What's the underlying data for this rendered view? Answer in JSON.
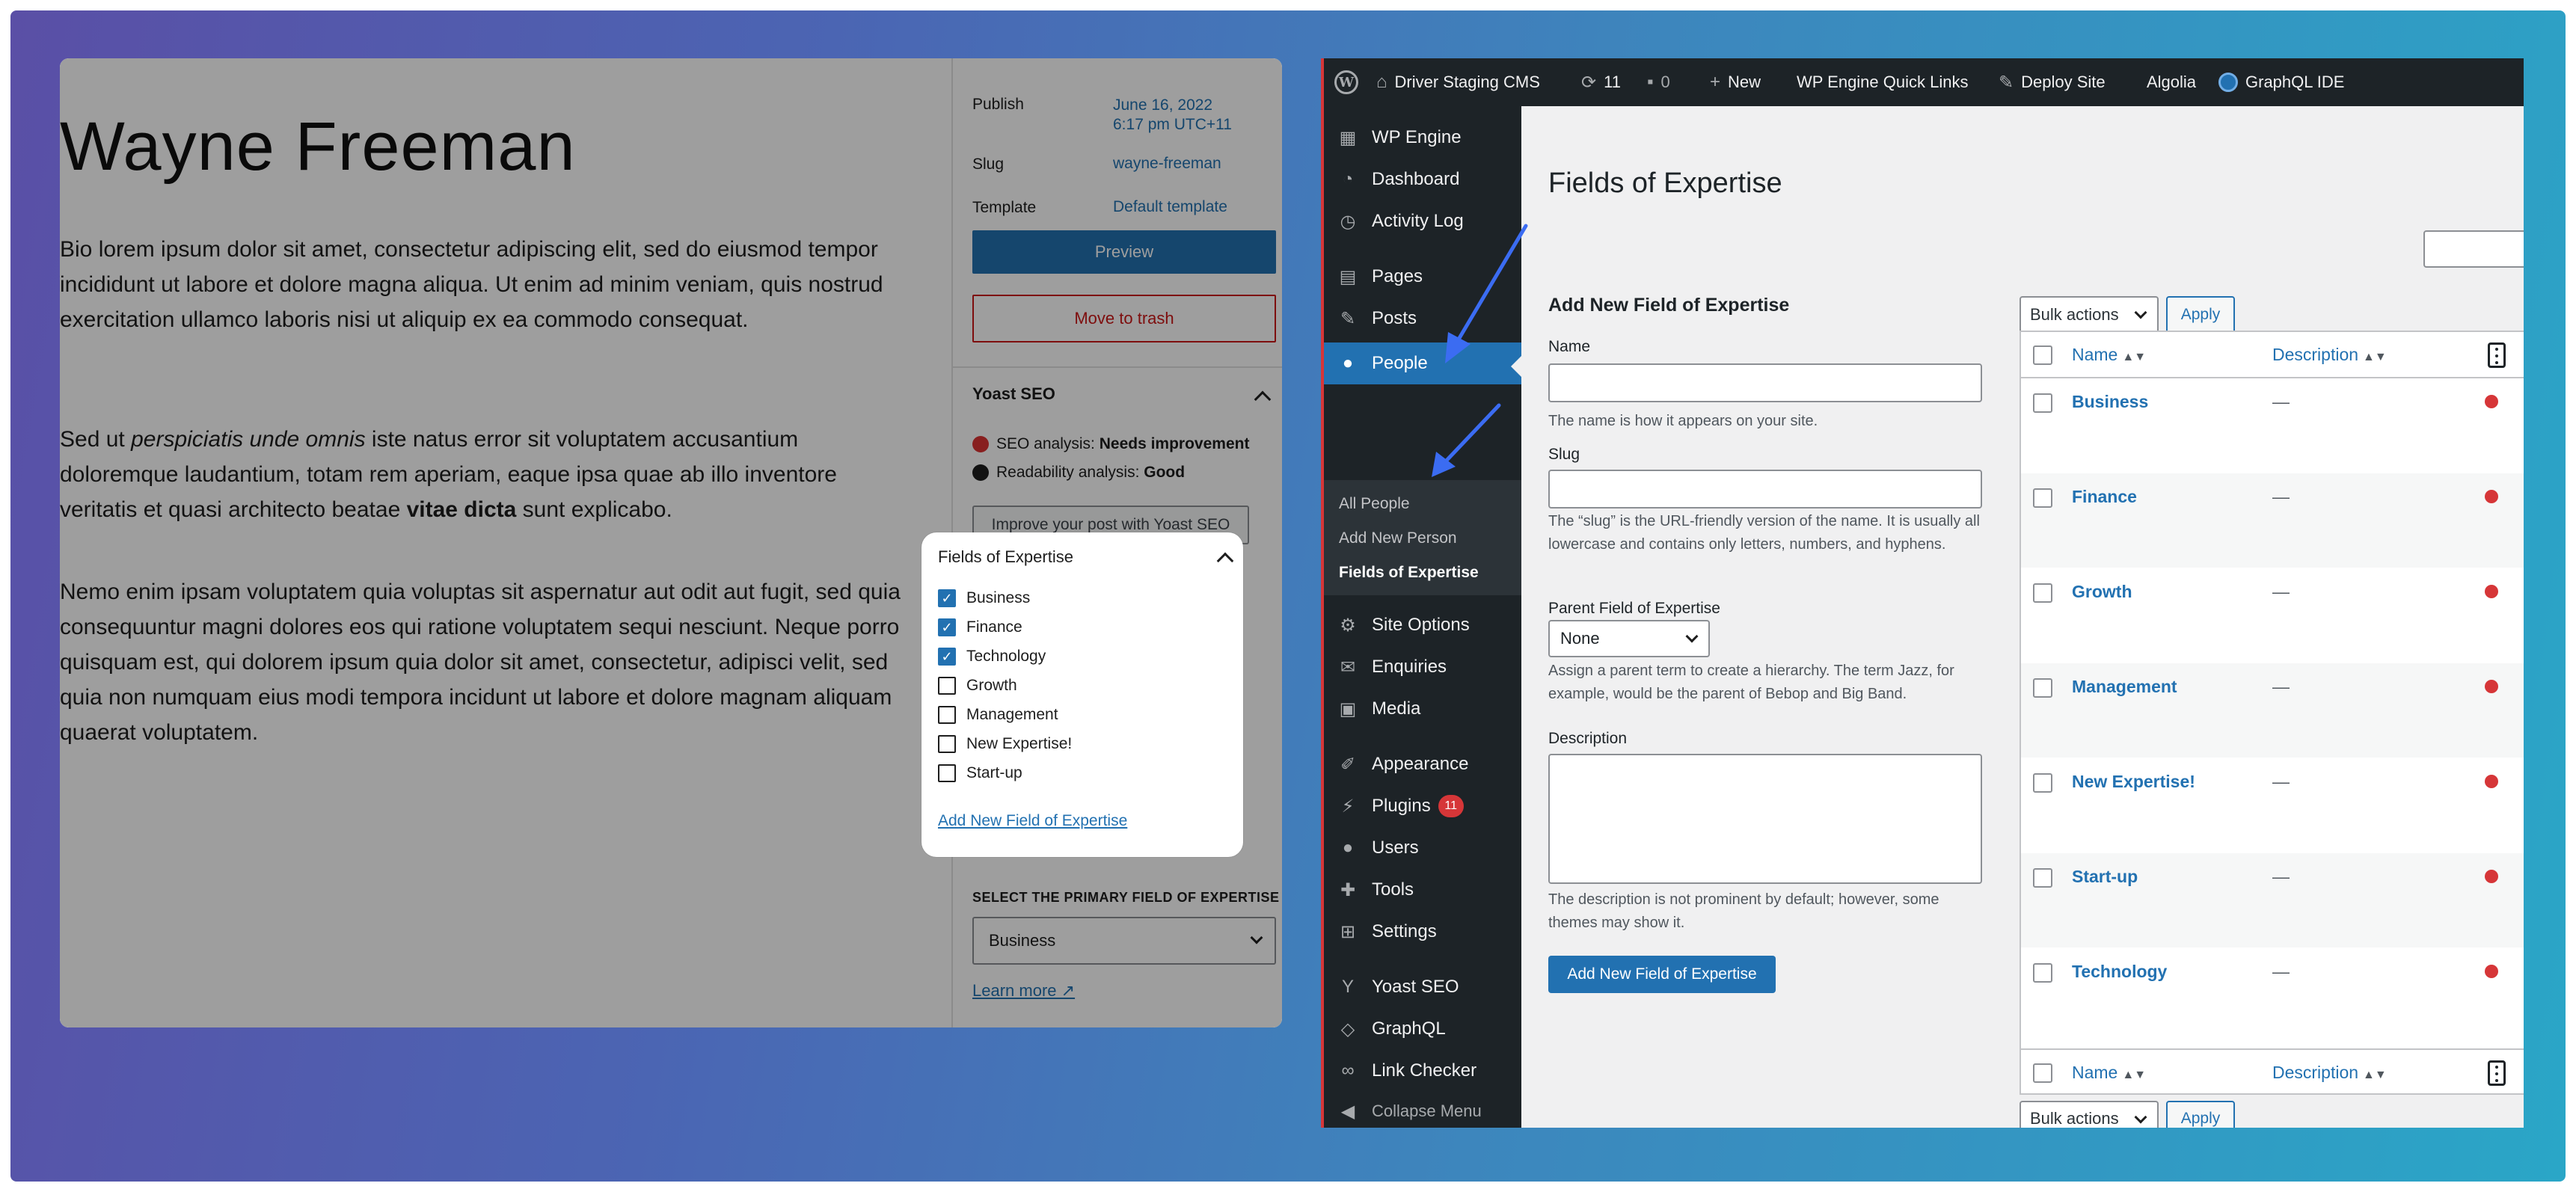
{
  "editor": {
    "post_title": "Wayne Freeman",
    "p1": "Bio lorem ipsum dolor sit amet, consectetur adipiscing elit, sed do eiusmod tempor incididunt ut labore et dolore magna aliqua. Ut enim ad minim veniam, quis nostrud exercitation ullamco laboris nisi ut aliquip ex ea commodo consequat.",
    "p2_a": "Sed ut ",
    "p2_em": "perspiciatis unde omnis",
    "p2_b": " iste natus error sit voluptatem accusantium doloremque laudantium, totam rem aperiam, eaque ipsa quae ab illo inventore veritatis et quasi architecto beatae ",
    "p2_strong": "vitae dicta",
    "p2_c": " sunt explicabo.",
    "p3": "Nemo enim ipsam voluptatem quia voluptas sit aspernatur aut odit aut fugit, sed quia consequuntur magni dolores eos qui ratione voluptatem sequi nesciunt. Neque porro quisquam est, qui dolorem ipsum quia dolor sit amet, consectetur, adipisci velit, sed quia non numquam eius modi tempora incidunt ut labore et dolore magnam aliquam quaerat voluptatem."
  },
  "sidebar": {
    "publish_label": "Publish",
    "publish_date": "June 16, 2022",
    "publish_time": "6:17 pm UTC+11",
    "slug_label": "Slug",
    "slug_value": "wayne-freeman",
    "template_label": "Template",
    "template_value": "Default template",
    "preview_label": "Preview",
    "trash_label": "Move to trash",
    "yoast_title": "Yoast SEO",
    "seo_label": "SEO analysis: ",
    "seo_value": "Needs improvement",
    "read_label": "Readability analysis: ",
    "read_value": "Good",
    "improve_label": "Improve your post with Yoast SEO",
    "primary_label": "SELECT THE PRIMARY FIELD OF EXPERTISE",
    "primary_value": "Business",
    "learn_more": "Learn more ↗"
  },
  "foe_panel": {
    "title": "Fields of Expertise",
    "items": [
      {
        "label": "Business",
        "checked": true
      },
      {
        "label": "Finance",
        "checked": true
      },
      {
        "label": "Technology",
        "checked": true
      },
      {
        "label": "Growth",
        "checked": false
      },
      {
        "label": "Management",
        "checked": false
      },
      {
        "label": "New Expertise!",
        "checked": false
      },
      {
        "label": "Start-up",
        "checked": false
      }
    ],
    "add_link": "Add New Field of Expertise"
  },
  "adminbar": {
    "site_name": "Driver Staging CMS",
    "updates_count": "11",
    "comments_count": "0",
    "new_label": "New",
    "quick_links": "WP Engine Quick Links",
    "deploy": "Deploy Site",
    "algolia": "Algolia",
    "graphql_ide": "GraphQL IDE"
  },
  "menu": {
    "wp_engine": "WP Engine",
    "dashboard": "Dashboard",
    "activity_log": "Activity Log",
    "pages": "Pages",
    "posts": "Posts",
    "people": "People",
    "sub_all": "All People",
    "sub_add": "Add New Person",
    "sub_foe": "Fields of Expertise",
    "site_options": "Site Options",
    "enquiries": "Enquiries",
    "media": "Media",
    "appearance": "Appearance",
    "plugins": "Plugins",
    "plugins_badge": "11",
    "users": "Users",
    "tools": "Tools",
    "settings": "Settings",
    "yoast": "Yoast SEO",
    "graphql": "GraphQL",
    "link_checker": "Link Checker",
    "collapse": "Collapse Menu"
  },
  "admin": {
    "page_title": "Fields of Expertise",
    "form_title": "Add New Field of Expertise",
    "name_label": "Name",
    "name_help": "The name is how it appears on your site.",
    "slug_label": "Slug",
    "slug_help": "The “slug” is the URL-friendly version of the name. It is usually all lowercase and contains only letters, numbers, and hyphens.",
    "parent_label": "Parent Field of Expertise",
    "parent_value": "None",
    "parent_help": "Assign a parent term to create a hierarchy. The term Jazz, for example, would be the parent of Bebop and Big Band.",
    "desc_label": "Description",
    "desc_help": "The description is not prominent by default; however, some themes may show it.",
    "add_button": "Add New Field of Expertise",
    "bulk_label": "Bulk actions",
    "apply_label": "Apply",
    "col_name": "Name",
    "col_desc": "Description",
    "rows": [
      {
        "name": "Business",
        "desc": "—"
      },
      {
        "name": "Finance",
        "desc": "—"
      },
      {
        "name": "Growth",
        "desc": "—"
      },
      {
        "name": "Management",
        "desc": "—"
      },
      {
        "name": "New Expertise!",
        "desc": "—"
      },
      {
        "name": "Start-up",
        "desc": "—"
      },
      {
        "name": "Technology",
        "desc": "—"
      }
    ]
  },
  "colors": {
    "accent": "#2271b1",
    "admin_dark": "#1d2327",
    "danger": "#d63638",
    "annotation_arrow": "#3b6cf2"
  }
}
